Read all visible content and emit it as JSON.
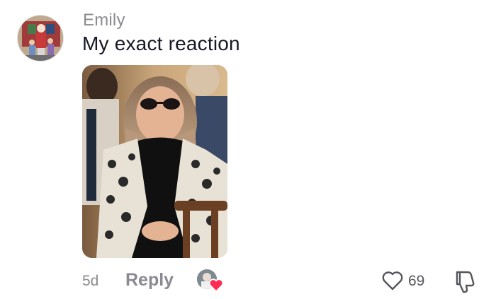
{
  "comment": {
    "username": "Emily",
    "text": "My exact reaction",
    "avatar_icon": "profile-photo-family",
    "photo_icon": "woman-sunglasses-photo"
  },
  "footer": {
    "time": "5d",
    "reply_label": "Reply",
    "like_count": "69",
    "like_icon": "heart-outline-icon",
    "dislike_icon": "thumbs-down-icon",
    "creator_liked_icon": "creator-liked-heart-icon"
  },
  "colors": {
    "secondary_text": "#8a8b91",
    "primary_text": "#161823",
    "heart_red": "#fe2c55"
  }
}
